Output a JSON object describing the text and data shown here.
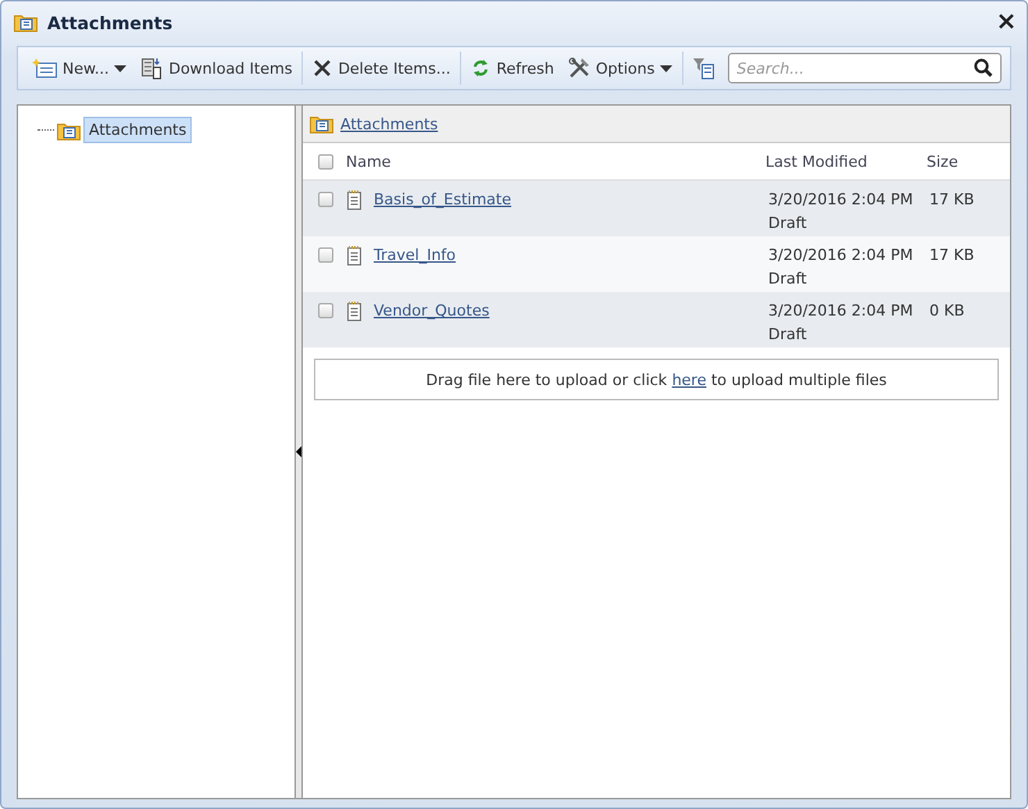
{
  "window": {
    "title": "Attachments",
    "close": "×"
  },
  "toolbar": {
    "items": [
      {
        "kind": "button",
        "label": "New...",
        "dropdown": true
      },
      {
        "kind": "button",
        "label": "Download Items",
        "dropdown": false
      },
      {
        "kind": "separator"
      },
      {
        "kind": "button",
        "label": "Delete Items...",
        "dropdown": false
      },
      {
        "kind": "separator"
      },
      {
        "kind": "button",
        "label": "Refresh",
        "dropdown": false
      },
      {
        "kind": "button",
        "label": "Options",
        "dropdown": true
      },
      {
        "kind": "separator"
      },
      {
        "kind": "icon_button"
      }
    ],
    "search": {
      "placeholder": "Search..."
    }
  },
  "tree": {
    "items": [
      {
        "label": "Attachments",
        "selected": true
      }
    ]
  },
  "breadcrumb": "Attachments",
  "table": {
    "select_all": {
      "checked": false
    },
    "columns": [
      "Name",
      "Last Modified",
      "Size"
    ],
    "rows": [
      {
        "checked": false,
        "name": "Basis_of_Estimate",
        "modified": "3/20/2016 2:04 PM",
        "status": "Draft",
        "size": "17 KB"
      },
      {
        "checked": false,
        "name": "Travel_Info",
        "modified": "3/20/2016 2:04 PM",
        "status": "Draft",
        "size": "17 KB"
      },
      {
        "checked": false,
        "name": "Vendor_Quotes",
        "modified": "3/20/2016 2:04 PM",
        "status": "Draft",
        "size": "0 KB"
      }
    ]
  },
  "upload": {
    "before": "Drag file here to upload or click ",
    "link": "here",
    "after": " to upload multiple files"
  }
}
